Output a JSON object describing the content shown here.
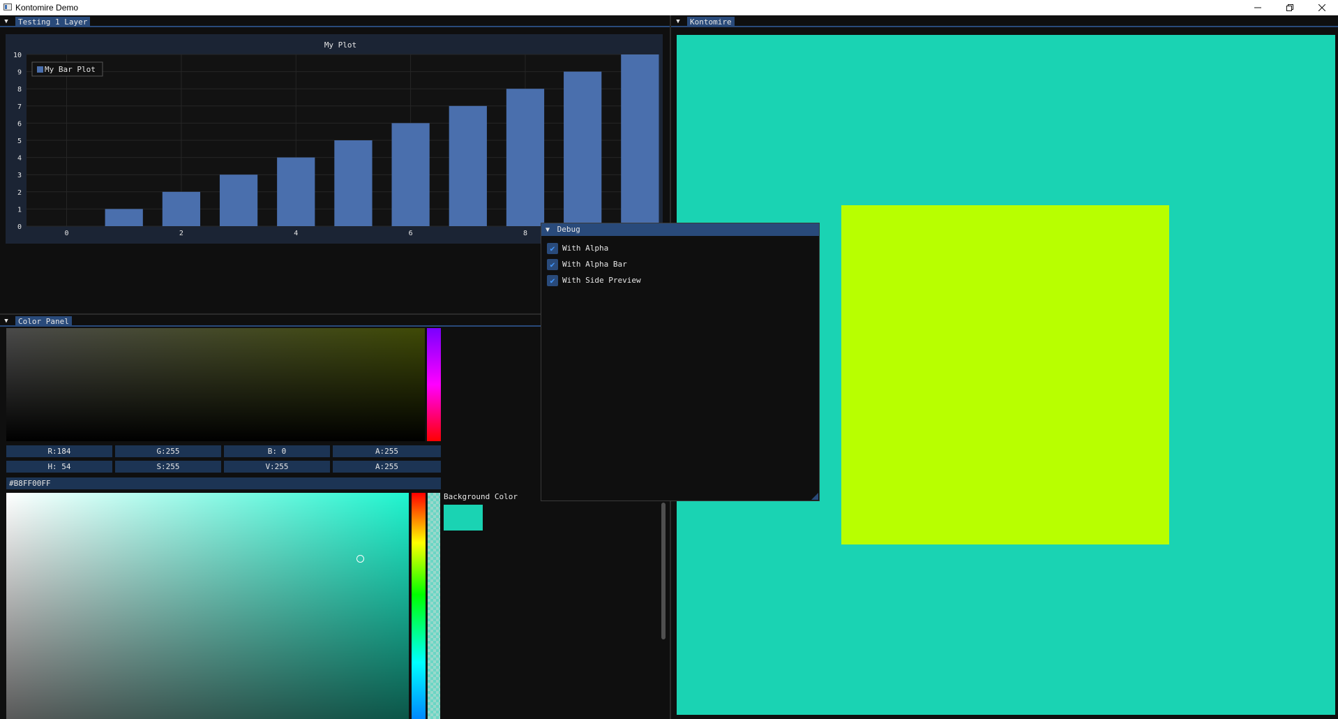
{
  "window": {
    "title": "Kontomire Demo",
    "minimize_icon": "minimize-icon",
    "maximize_icon": "restore-icon",
    "close_icon": "close-icon"
  },
  "panels": {
    "testing_tab": "Testing 1 Layer",
    "kontomire_tab": "Kontomire",
    "color_panel_tab": "Color Panel"
  },
  "chart_data": {
    "type": "bar",
    "title": "My Plot",
    "series": [
      {
        "name": "My Bar Plot",
        "x": [
          0,
          1,
          2,
          3,
          4,
          5,
          6,
          7,
          8,
          9,
          10
        ],
        "values": [
          0,
          1,
          2,
          3,
          4,
          5,
          6,
          7,
          8,
          9,
          10
        ]
      }
    ],
    "x_ticks": [
      "0",
      "2",
      "4",
      "6",
      "8"
    ],
    "y_ticks": [
      "0",
      "1",
      "2",
      "3",
      "4",
      "5",
      "6",
      "7",
      "8",
      "9",
      "10"
    ],
    "xlim": [
      -0.7,
      10.3
    ],
    "ylim": [
      0,
      10
    ],
    "grid": true,
    "legend_position": "top-left",
    "bar_color": "#4a6fad"
  },
  "debug_window": {
    "title": "Debug",
    "options": [
      {
        "label": "With Alpha",
        "checked": true
      },
      {
        "label": "With Alpha Bar",
        "checked": true
      },
      {
        "label": "With Side Preview",
        "checked": true
      }
    ]
  },
  "color_panel": {
    "rgba": {
      "r": "R:184",
      "g": "G:255",
      "b": "B:  0",
      "a": "A:255"
    },
    "hsva": {
      "h": "H: 54",
      "s": "S:255",
      "v": "V:255",
      "a": "A:255"
    },
    "hex": "#B8FF00FF",
    "background_label": "Background Color",
    "background_color": "#1ad3b3",
    "foreground_color": "#b8ff00"
  },
  "colors": {
    "accent": "#294a7a",
    "viewport_bg": "#1ad3b3",
    "square": "#b8ff00"
  }
}
